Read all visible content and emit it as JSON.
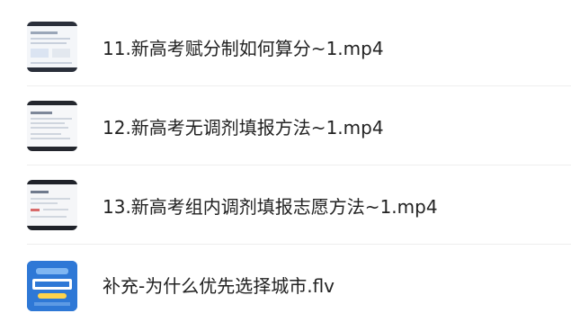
{
  "files": [
    {
      "name": "11.新高考赋分制如何算分~1.mp4",
      "thumb": "document-thumbnail-icon"
    },
    {
      "name": "12.新高考无调剂填报方法~1.mp4",
      "thumb": "document-thumbnail-icon"
    },
    {
      "name": "13.新高考组内调剂填报志愿方法~1.mp4",
      "thumb": "document-thumbnail-icon"
    },
    {
      "name": "补充-为什么优先选择城市.flv",
      "thumb": "blue-cover-thumbnail-icon"
    }
  ],
  "colors": {
    "text": "#222222",
    "divider": "#eeeeee",
    "cover_blue": "#2e78d6"
  }
}
